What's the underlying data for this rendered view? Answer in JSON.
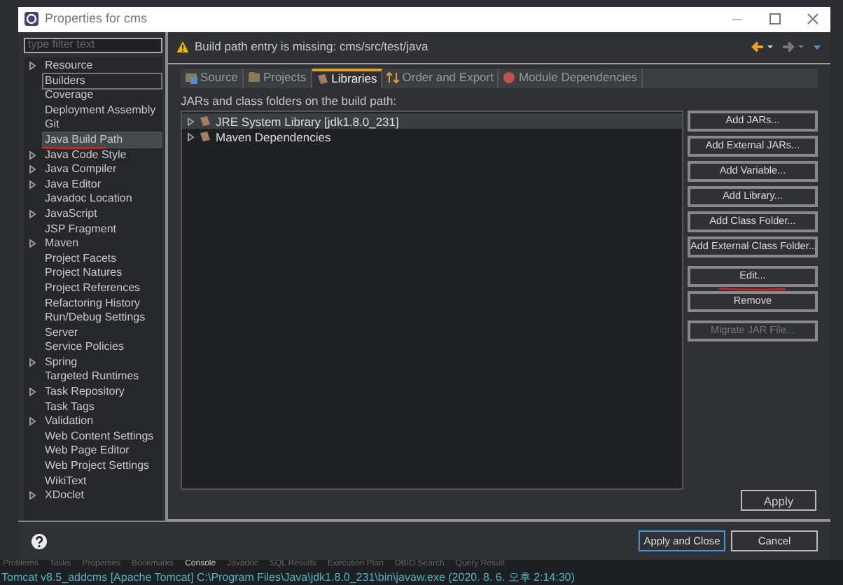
{
  "window": {
    "title": "Properties for cms"
  },
  "filter": {
    "placeholder": "type filter text"
  },
  "tree": [
    {
      "label": "Resource",
      "expandable": true,
      "selected": false,
      "focused": false
    },
    {
      "label": "Builders",
      "expandable": false,
      "selected": false,
      "focused": true
    },
    {
      "label": "Coverage",
      "expandable": false,
      "selected": false,
      "focused": false
    },
    {
      "label": "Deployment Assembly",
      "expandable": false,
      "selected": false,
      "focused": false
    },
    {
      "label": "Git",
      "expandable": false,
      "selected": false,
      "focused": false
    },
    {
      "label": "Java Build Path",
      "expandable": false,
      "selected": true,
      "focused": false
    },
    {
      "label": "Java Code Style",
      "expandable": true,
      "selected": false,
      "focused": false
    },
    {
      "label": "Java Compiler",
      "expandable": true,
      "selected": false,
      "focused": false
    },
    {
      "label": "Java Editor",
      "expandable": true,
      "selected": false,
      "focused": false
    },
    {
      "label": "Javadoc Location",
      "expandable": false,
      "selected": false,
      "focused": false
    },
    {
      "label": "JavaScript",
      "expandable": true,
      "selected": false,
      "focused": false
    },
    {
      "label": "JSP Fragment",
      "expandable": false,
      "selected": false,
      "focused": false
    },
    {
      "label": "Maven",
      "expandable": true,
      "selected": false,
      "focused": false
    },
    {
      "label": "Project Facets",
      "expandable": false,
      "selected": false,
      "focused": false
    },
    {
      "label": "Project Natures",
      "expandable": false,
      "selected": false,
      "focused": false
    },
    {
      "label": "Project References",
      "expandable": false,
      "selected": false,
      "focused": false
    },
    {
      "label": "Refactoring History",
      "expandable": false,
      "selected": false,
      "focused": false
    },
    {
      "label": "Run/Debug Settings",
      "expandable": false,
      "selected": false,
      "focused": false
    },
    {
      "label": "Server",
      "expandable": false,
      "selected": false,
      "focused": false
    },
    {
      "label": "Service Policies",
      "expandable": false,
      "selected": false,
      "focused": false
    },
    {
      "label": "Spring",
      "expandable": true,
      "selected": false,
      "focused": false
    },
    {
      "label": "Targeted Runtimes",
      "expandable": false,
      "selected": false,
      "focused": false
    },
    {
      "label": "Task Repository",
      "expandable": true,
      "selected": false,
      "focused": false
    },
    {
      "label": "Task Tags",
      "expandable": false,
      "selected": false,
      "focused": false
    },
    {
      "label": "Validation",
      "expandable": true,
      "selected": false,
      "focused": false
    },
    {
      "label": "Web Content Settings",
      "expandable": false,
      "selected": false,
      "focused": false
    },
    {
      "label": "Web Page Editor",
      "expandable": false,
      "selected": false,
      "focused": false
    },
    {
      "label": "Web Project Settings",
      "expandable": false,
      "selected": false,
      "focused": false
    },
    {
      "label": "WikiText",
      "expandable": false,
      "selected": false,
      "focused": false
    },
    {
      "label": "XDoclet",
      "expandable": true,
      "selected": false,
      "focused": false
    }
  ],
  "message": "Build path entry is missing: cms/src/test/java",
  "tabs": [
    {
      "label": "Source",
      "selected": false
    },
    {
      "label": "Projects",
      "selected": false
    },
    {
      "label": "Libraries",
      "selected": true
    },
    {
      "label": "Order and Export",
      "selected": false
    },
    {
      "label": "Module Dependencies",
      "selected": false
    }
  ],
  "list_label": "JARs and class folders on the build path:",
  "entries": [
    {
      "label": "JRE System Library [jdk1.8.0_231]",
      "selected": true
    },
    {
      "label": "Maven Dependencies",
      "selected": false
    }
  ],
  "button_groups": [
    [
      {
        "label": "Add JARs...",
        "disabled": false
      },
      {
        "label": "Add External JARs...",
        "disabled": false
      },
      {
        "label": "Add Variable...",
        "disabled": false
      },
      {
        "label": "Add Library...",
        "disabled": false
      },
      {
        "label": "Add Class Folder...",
        "disabled": false
      },
      {
        "label": "Add External Class Folder...",
        "disabled": false
      }
    ],
    [
      {
        "label": "Edit...",
        "disabled": false
      },
      {
        "label": "Remove",
        "disabled": false
      }
    ],
    [
      {
        "label": "Migrate JAR File...",
        "disabled": true
      }
    ]
  ],
  "apply": "Apply",
  "footer_buttons": [
    {
      "label": "Apply and Close",
      "default": true
    },
    {
      "label": "Cancel",
      "default": false
    }
  ],
  "views": [
    "Problems",
    "Tasks",
    "Properties",
    "Bookmarks",
    "Console",
    "Javadoc",
    "SQL Results",
    "Execution Plan",
    "DBIO Search",
    "Query Result"
  ],
  "console_line": "Tomcat v8.5_addcms [Apache Tomcat] C:\\Program Files\\Java\\jdk1.8.0_231\\bin\\javaw.exe  (2020. 8. 6. 오후 2:14:30)"
}
